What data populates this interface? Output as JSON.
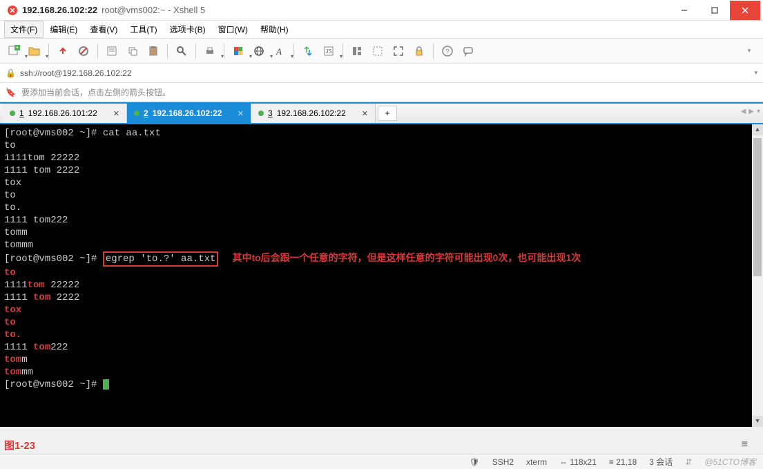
{
  "titlebar": {
    "host": "192.168.26.102:22",
    "rest": "root@vms002:~ - Xshell 5"
  },
  "menubar": {
    "items": [
      "文件(F)",
      "编辑(E)",
      "查看(V)",
      "工具(T)",
      "选项卡(B)",
      "窗口(W)",
      "帮助(H)"
    ]
  },
  "address": {
    "url": "ssh://root@192.168.26.102:22"
  },
  "hint": {
    "text": "要添加当前会话，点击左侧的箭头按钮。"
  },
  "tabs": [
    {
      "num": "1",
      "label": "192.168.26.101:22",
      "active": false
    },
    {
      "num": "2",
      "label": "192.168.26.102:22",
      "active": true
    },
    {
      "num": "3",
      "label": "192.168.26.102:22",
      "active": false
    }
  ],
  "terminal": {
    "prompt1_prefix": "[root@vms002 ~]# ",
    "cmd1": "cat aa.txt",
    "cat_output": [
      "to",
      "1111tom 22222",
      "1111 tom 2222",
      "tox",
      "to",
      "to.",
      "1111 tom222",
      "tomm",
      "tommm"
    ],
    "prompt2_prefix": "[root@vms002 ~]# ",
    "cmd2": "egrep 'to.?' aa.txt",
    "note": "其中to后会跟一个任意的字符，但是这样任意的字符可能出现0次，也可能出现1次",
    "egrep_output": [
      {
        "pre": "",
        "hl": "to",
        "post": ""
      },
      {
        "pre": "1111",
        "hl": "tom",
        "post": " 22222"
      },
      {
        "pre": "1111 ",
        "hl": "tom",
        "post": " 2222"
      },
      {
        "pre": "",
        "hl": "tox",
        "post": ""
      },
      {
        "pre": "",
        "hl": "to",
        "post": ""
      },
      {
        "pre": "",
        "hl": "to.",
        "post": ""
      },
      {
        "pre": "1111 ",
        "hl": "tom",
        "post": "222"
      },
      {
        "pre": "",
        "hl": "tom",
        "post": "m"
      },
      {
        "pre": "",
        "hl": "tom",
        "post": "mm"
      }
    ],
    "prompt3_prefix": "[root@vms002 ~]# "
  },
  "figure_label": "图1-23",
  "statusbar": {
    "protocol": "SSH2",
    "term": "xterm",
    "size": "118x21",
    "pos": "21,18",
    "sessions": "3 会话",
    "watermark": "@51CTO博客"
  },
  "icons": {
    "lock": "🔒",
    "bookmark": "🔖",
    "shield": "🛡"
  }
}
